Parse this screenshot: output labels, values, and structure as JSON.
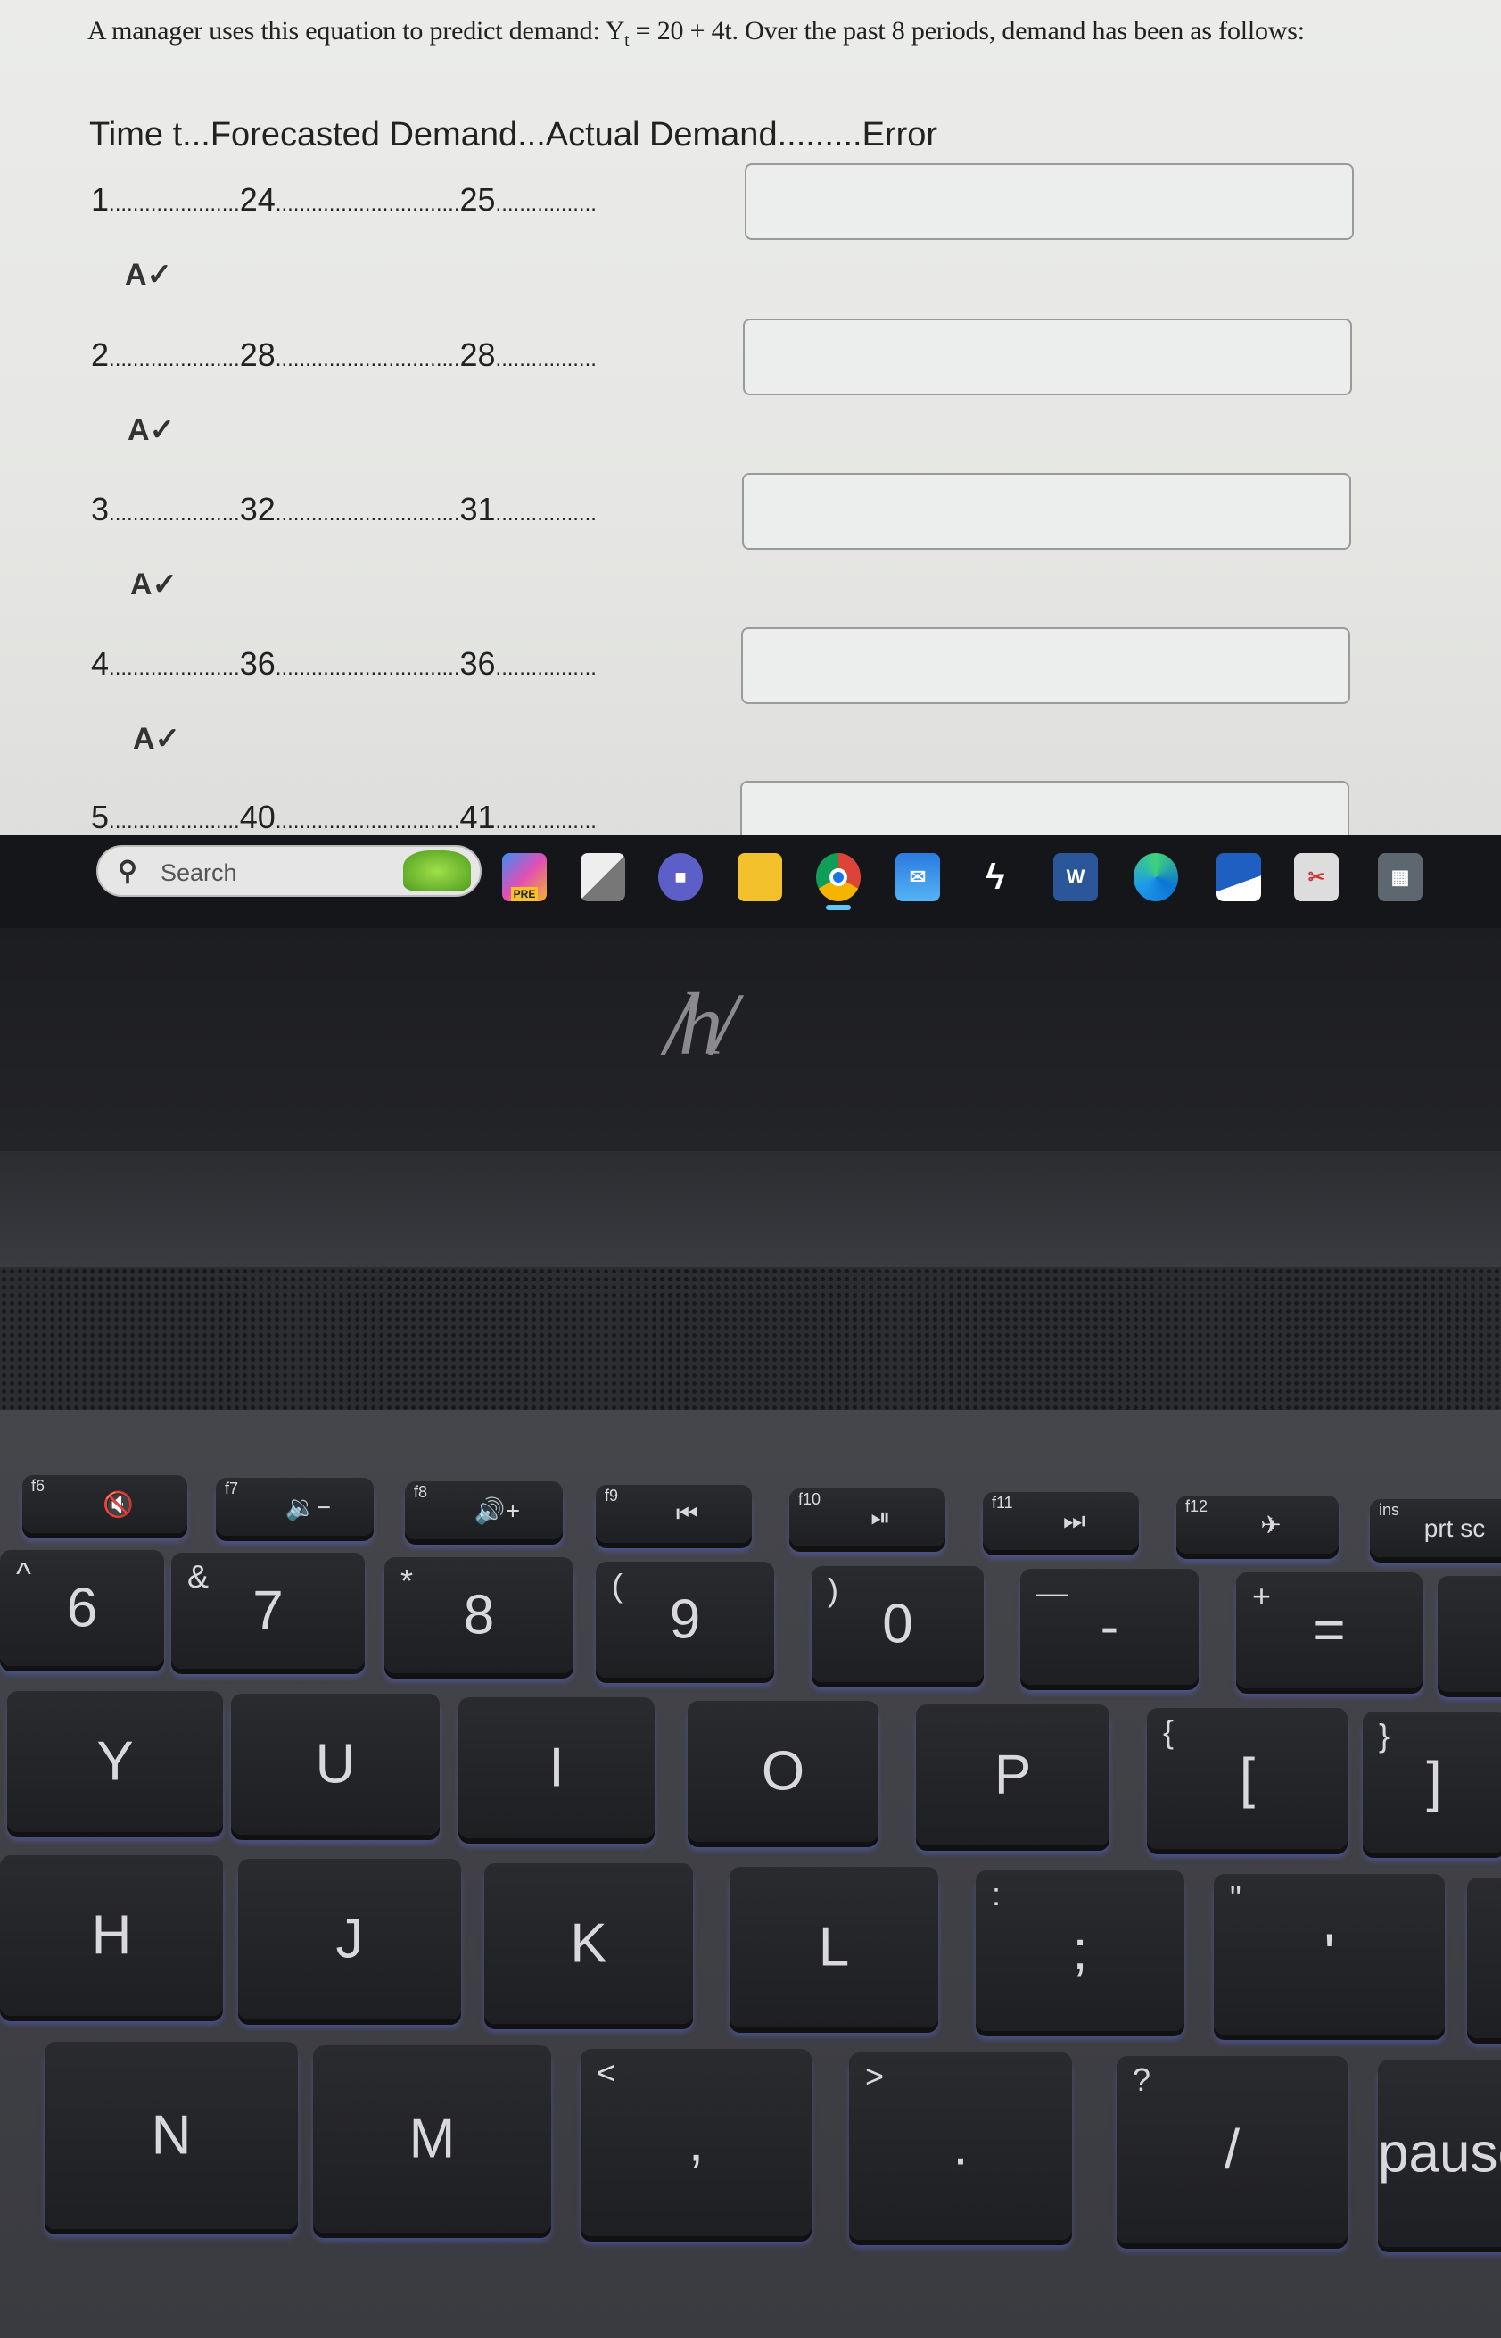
{
  "question": {
    "prefix": "A manager uses this equation to predict demand: Y",
    "sub": "t",
    "suffix": " = 20 + 4t. Over the past 8 periods, demand has been as follows:"
  },
  "table_header": "Time t...Forecasted Demand...Actual Demand.........Error",
  "rows": [
    {
      "t": "1",
      "forecast": "24",
      "actual": "25",
      "error": ""
    },
    {
      "t": "2",
      "forecast": "28",
      "actual": "28",
      "error": ""
    },
    {
      "t": "3",
      "forecast": "32",
      "actual": "31",
      "error": ""
    },
    {
      "t": "4",
      "forecast": "36",
      "actual": "36",
      "error": ""
    },
    {
      "t": "5",
      "forecast": "40",
      "actual": "41",
      "error": ""
    }
  ],
  "spellcheck_icon": "A✓",
  "taskbar": {
    "search_label": "Search",
    "icons": [
      "windows-start",
      "copilot",
      "task-view",
      "teams",
      "file-explorer",
      "chrome",
      "mail",
      "lightning-app",
      "word",
      "edge",
      "scanner",
      "snipping-tool",
      "calculator"
    ],
    "copilot_badge": "PRE",
    "word_letter": "W"
  },
  "brand_logo": "hp",
  "keyboard": {
    "keys": [
      {
        "main": "🔇",
        "sub": "f6"
      },
      {
        "main": "🔉−",
        "sub": "f7"
      },
      {
        "main": "🔊+",
        "sub": "f8"
      },
      {
        "main": "⏮",
        "sub": "f9"
      },
      {
        "main": "⏯",
        "sub": "f10"
      },
      {
        "main": "⏭",
        "sub": "f11"
      },
      {
        "main": "✈",
        "sub": "f12"
      },
      {
        "main": "prt sc",
        "sub": "ins"
      },
      {
        "main": "6",
        "sub": "^"
      },
      {
        "main": "7",
        "sub": "&"
      },
      {
        "main": "8",
        "sub": "*"
      },
      {
        "main": "9",
        "sub": "("
      },
      {
        "main": "0",
        "sub": ")"
      },
      {
        "main": "-",
        "sub": "—"
      },
      {
        "main": "=",
        "sub": "+"
      },
      {
        "main": "",
        "sub": ""
      },
      {
        "main": "Y",
        "sub": ""
      },
      {
        "main": "U",
        "sub": ""
      },
      {
        "main": "I",
        "sub": ""
      },
      {
        "main": "O",
        "sub": ""
      },
      {
        "main": "P",
        "sub": ""
      },
      {
        "main": "[",
        "sub": "{"
      },
      {
        "main": "]",
        "sub": "}"
      },
      {
        "main": "H",
        "sub": ""
      },
      {
        "main": "J",
        "sub": ""
      },
      {
        "main": "K",
        "sub": ""
      },
      {
        "main": "L",
        "sub": ""
      },
      {
        "main": ";",
        "sub": ":"
      },
      {
        "main": "'",
        "sub": "\""
      },
      {
        "main": "",
        "sub": ""
      },
      {
        "main": "N",
        "sub": ""
      },
      {
        "main": "M",
        "sub": ""
      },
      {
        "main": ",",
        "sub": "<"
      },
      {
        "main": ".",
        "sub": ">"
      },
      {
        "main": "/",
        "sub": "?"
      },
      {
        "main": "pause",
        "sub": ""
      }
    ]
  }
}
